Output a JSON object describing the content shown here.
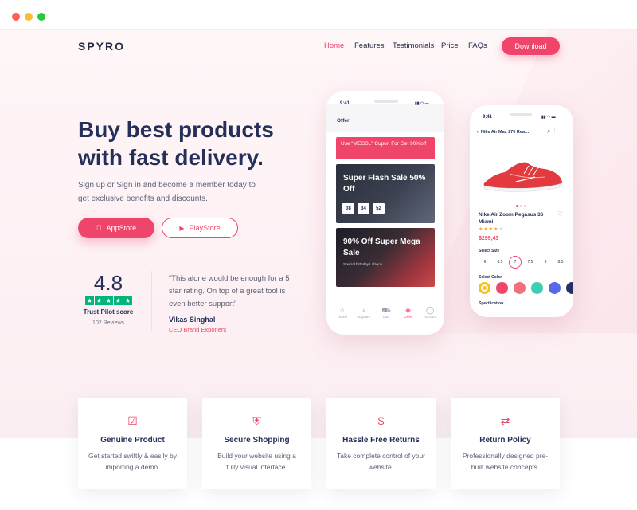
{
  "browser": {
    "dot_colors": [
      "#ff5f56",
      "#ffbd2e",
      "#27c93f"
    ]
  },
  "brand": {
    "logo": "SPYRO",
    "accent": "#f0456b"
  },
  "nav": {
    "items": [
      "Home",
      "Features",
      "Testimonials",
      "Price",
      "FAQs"
    ],
    "download": "Download"
  },
  "hero": {
    "title": "Buy best products with fast delivery.",
    "subtitle": "Sign up or Sign in and become a member today to get exclusive benefits and discounts.",
    "appstore": "AppStore",
    "playstore": "PlayStore"
  },
  "rating": {
    "score": "4.8",
    "label": "Trust Pilot score",
    "count": "102 Reviews",
    "stars": 5
  },
  "testimonial": {
    "quote": "“This alone would be enough for a 5 star rating. On top of a great tool is even better support”",
    "name": "Vikas Singhal",
    "role": "CEO Brand Exponent"
  },
  "phone1": {
    "time": "9:41",
    "title": "Offer",
    "cupon": "Use “MEGSL” Cupon For Get 90%off",
    "sale1": {
      "title": "Super Flash Sale 50% Off",
      "timer": [
        "08",
        "34",
        "52"
      ]
    },
    "sale2": {
      "title": "90% Off Super Mega Sale",
      "sub": "Special birthday Lafayon"
    },
    "tabs": [
      {
        "label": "Home",
        "icon": "home-icon",
        "glyph": "⌂"
      },
      {
        "label": "Explore",
        "icon": "search-icon",
        "glyph": "⌕"
      },
      {
        "label": "Cart",
        "icon": "cart-icon",
        "glyph": "⛟"
      },
      {
        "label": "Offer",
        "icon": "tag-icon",
        "glyph": "◈"
      },
      {
        "label": "Account",
        "icon": "user-icon",
        "glyph": "◯"
      }
    ]
  },
  "phone2": {
    "time": "9:41",
    "header": "Nike Air Max 270 Rea…",
    "product_name": "Nike Air Zoom Pegasus 36 Miami",
    "price": "$299,43",
    "select_size": "Select Size",
    "sizes": [
      "6",
      "6.5",
      "7",
      "7.5",
      "8",
      "8.5"
    ],
    "selected_size": "7",
    "select_color": "Select Color",
    "colors": [
      "#f7c21b",
      "#f0456b",
      "#f26f7e",
      "#3ecfb0",
      "#5a68e8",
      "#223066"
    ],
    "specification": "Specification"
  },
  "features": [
    {
      "icon": "check-circle-icon",
      "glyph": "☑",
      "title": "Genuine Product",
      "desc": "Get started swiftly & easily by importing a demo."
    },
    {
      "icon": "shield-icon",
      "glyph": "⛨",
      "title": "Secure Shopping",
      "desc": "Build your website using a fully visual interface."
    },
    {
      "icon": "dollar-icon",
      "glyph": "$",
      "title": "Hassle Free Returns",
      "desc": "Take complete control of your website."
    },
    {
      "icon": "return-icon",
      "glyph": "⇄",
      "title": "Return Policy",
      "desc": "Professionally designed pre-built website concepts."
    }
  ]
}
